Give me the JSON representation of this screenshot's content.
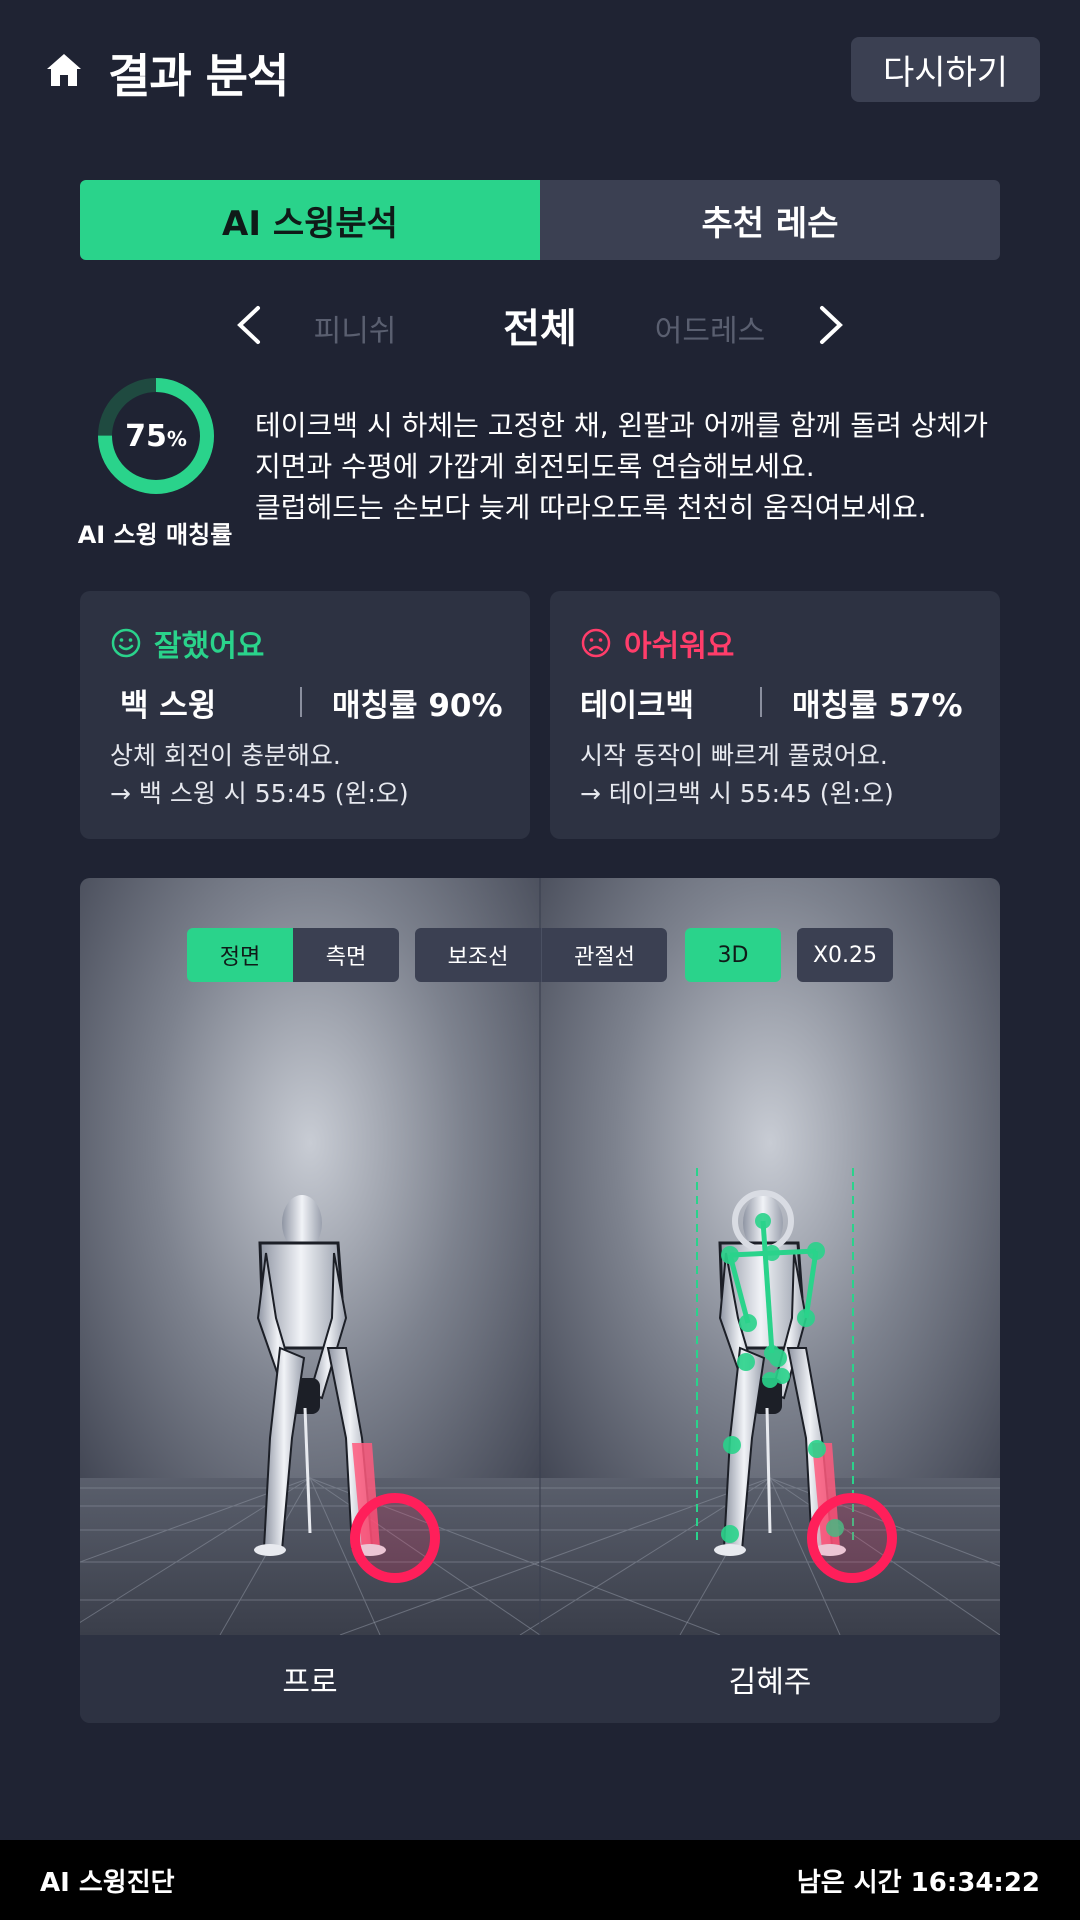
{
  "header": {
    "title": "결과 분석",
    "retry_label": "다시하기"
  },
  "tabs": [
    {
      "label": "AI 스윙분석",
      "active": true
    },
    {
      "label": "추천 레슨",
      "active": false
    }
  ],
  "phase": {
    "prev": "피니쉬",
    "current": "전체",
    "next": "어드레스"
  },
  "match": {
    "value": 75,
    "percent_text": "75",
    "unit": "%",
    "label": "AI 스윙 매칭률"
  },
  "description": [
    "테이크백 시 하체는 고정한 채, 왼팔과 어깨를 함께 돌려 상체가",
    "지면과 수평에 가깝게 회전되도록 연습해보세요.",
    "클럽헤드는 손보다 늦게 따라오도록 천천히 움직여보세요."
  ],
  "good_card": {
    "title": "잘했어요",
    "name": "백 스윙",
    "rate": "매칭률 90%",
    "line1": "상체 회전이 충분해요.",
    "line2": "→ 백 스윙 시 55:45 (왼:오)"
  },
  "bad_card": {
    "title": "아쉬워요",
    "name": "테이크백",
    "rate": "매칭률 57%",
    "line1": "시작 동작이 빠르게 풀렸어요.",
    "line2": "→ 테이크백 시 55:45 (왼:오)"
  },
  "viewer": {
    "toolbar": {
      "view_front": "정면",
      "view_side": "측면",
      "aux_line": "보조선",
      "joint_line": "관절선",
      "mode_3d": "3D",
      "speed": "X0.25"
    },
    "left_label": "프로",
    "right_label": "김혜주"
  },
  "footer": {
    "left": "AI 스윙진단",
    "right": "남은 시간 16:34:22"
  },
  "colors": {
    "accent": "#2ad38b",
    "warning": "#ff3d6a",
    "background": "#1f2333",
    "card": "#2d3242"
  }
}
